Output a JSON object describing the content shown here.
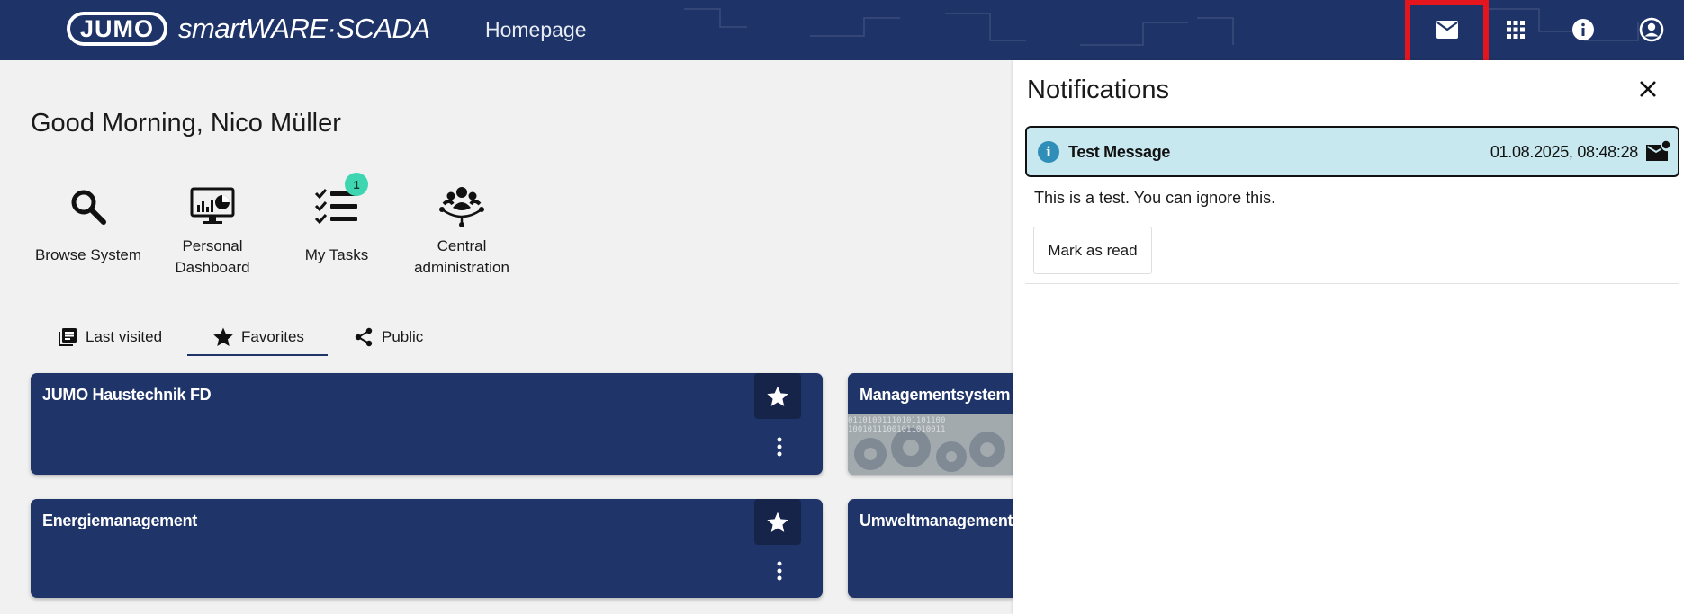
{
  "header": {
    "logo_brand": "JUMO",
    "logo_product": "smartWARE·SCADA",
    "nav_title": "Homepage",
    "icons": [
      "mail-icon",
      "apps-grid-icon",
      "info-icon",
      "account-circle-icon"
    ]
  },
  "greeting": "Good Morning,  Nico Müller",
  "quick_actions": [
    {
      "label": "Browse System",
      "icon": "search-icon"
    },
    {
      "label": "Personal Dashboard",
      "icon": "dashboard-monitor-icon"
    },
    {
      "label": "My Tasks",
      "icon": "task-list-icon",
      "badge": "1"
    },
    {
      "label": "Central administration",
      "icon": "admin-network-icon"
    }
  ],
  "tabs": [
    {
      "label": "Last visited",
      "icon": "library-books-icon"
    },
    {
      "label": "Favorites",
      "icon": "star-icon",
      "active": true
    },
    {
      "label": "Public",
      "icon": "share-icon"
    }
  ],
  "cards": [
    {
      "title": "JUMO Haustechnik FD"
    },
    {
      "title": "Managementsystem"
    },
    {
      "title": "Energiemanagement"
    },
    {
      "title": "Umweltmanagement"
    }
  ],
  "notifications": {
    "title": "Notifications",
    "items": [
      {
        "subject": "Test Message",
        "timestamp": "01.08.2025, 08:48:28",
        "body": "This is a test. You can ignore this.",
        "action_label": "Mark as read"
      }
    ]
  },
  "colors": {
    "header_bg": "#1e3468",
    "card_bg": "#1f3469",
    "highlight_red": "#e5151d",
    "notification_bg": "#c7e8ef",
    "badge": "#3ed6b0"
  }
}
